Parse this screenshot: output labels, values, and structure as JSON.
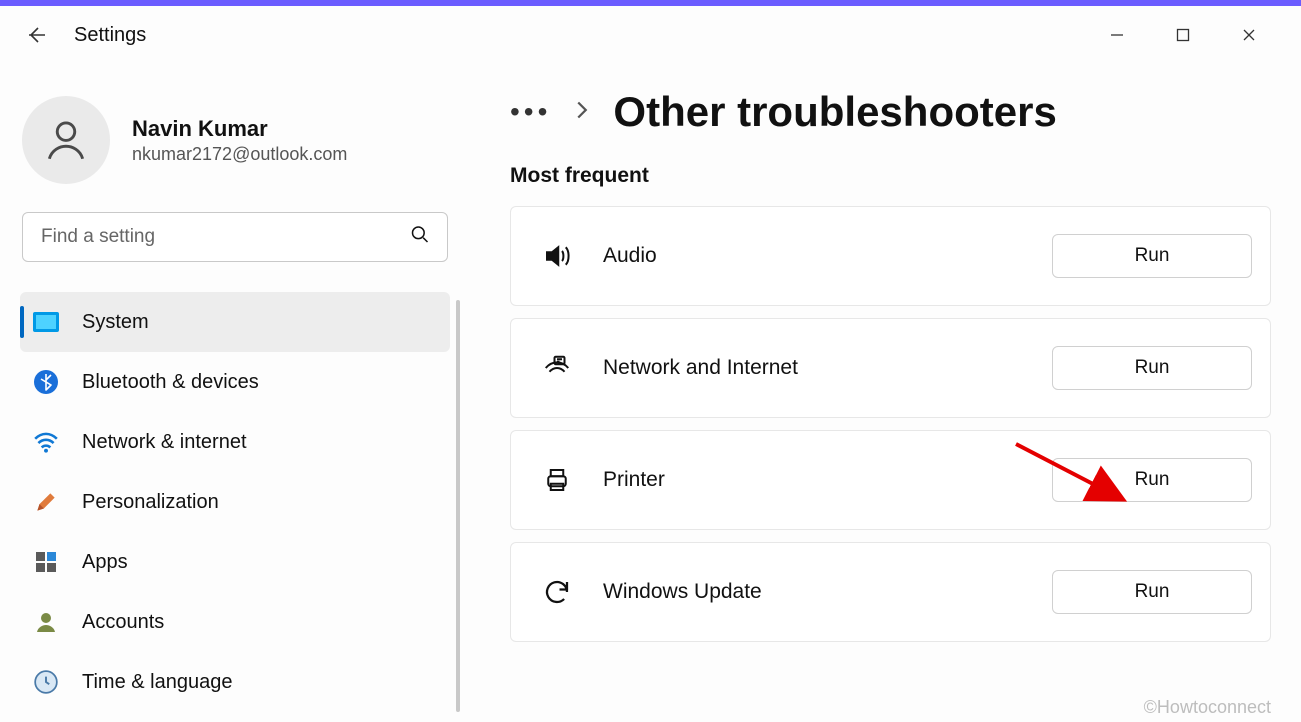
{
  "app": {
    "title": "Settings"
  },
  "profile": {
    "name": "Navin Kumar",
    "email": "nkumar2172@outlook.com"
  },
  "search": {
    "placeholder": "Find a setting"
  },
  "sidebar": {
    "items": [
      {
        "label": "System",
        "icon": "system-icon",
        "selected": true
      },
      {
        "label": "Bluetooth & devices",
        "icon": "bluetooth-icon"
      },
      {
        "label": "Network & internet",
        "icon": "wifi-icon"
      },
      {
        "label": "Personalization",
        "icon": "brush-icon"
      },
      {
        "label": "Apps",
        "icon": "apps-icon"
      },
      {
        "label": "Accounts",
        "icon": "accounts-icon"
      },
      {
        "label": "Time & language",
        "icon": "clock-icon"
      }
    ]
  },
  "breadcrumb": {
    "dots": "•••",
    "title": "Other troubleshooters"
  },
  "section": {
    "label": "Most frequent"
  },
  "troubleshooters": [
    {
      "label": "Audio",
      "icon": "speaker-icon",
      "button": "Run"
    },
    {
      "label": "Network and Internet",
      "icon": "network-icon",
      "button": "Run"
    },
    {
      "label": "Printer",
      "icon": "printer-icon",
      "button": "Run"
    },
    {
      "label": "Windows Update",
      "icon": "update-icon",
      "button": "Run"
    }
  ],
  "watermark": "©Howtoconnect"
}
